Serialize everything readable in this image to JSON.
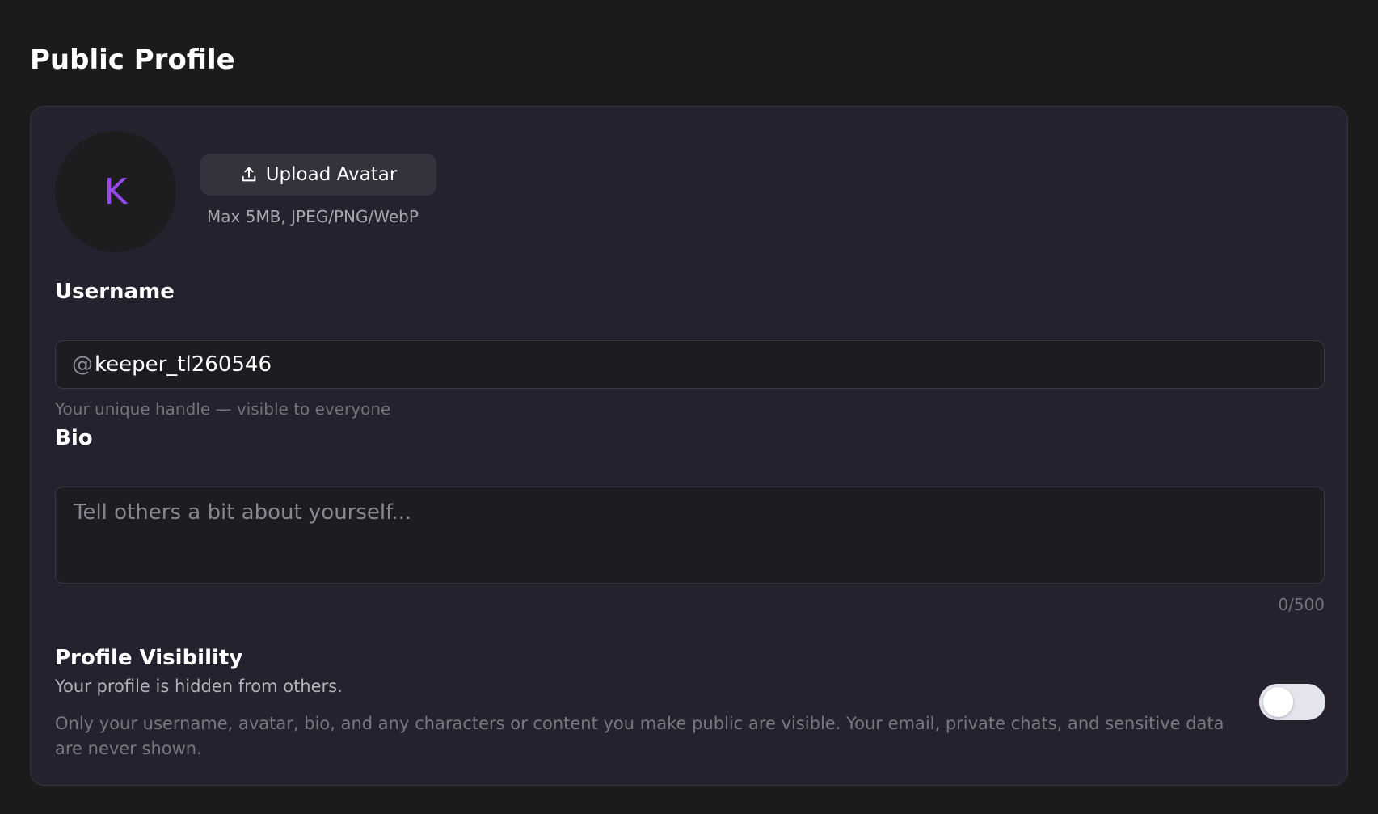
{
  "page": {
    "title": "Public Profile"
  },
  "avatar": {
    "initial": "K",
    "initial_color": "#9a49ee",
    "upload_label": "Upload Avatar",
    "upload_icon": "upload-icon",
    "hint": "Max 5MB, JPEG/PNG/WebP"
  },
  "username": {
    "label": "Username",
    "prefix": "@",
    "value": "keeper_tl260546",
    "helper": "Your unique handle — visible to everyone"
  },
  "bio": {
    "label": "Bio",
    "placeholder": "Tell others a bit about yourself...",
    "value": "",
    "char_count": "0/500"
  },
  "visibility": {
    "label": "Profile Visibility",
    "status": "Your profile is hidden from others.",
    "note": "Only your username, avatar, bio, and any characters or content you make public are visible. Your email, private chats, and sensitive data are never shown.",
    "enabled": false
  },
  "colors": {
    "background": "#1b1b1c",
    "card": "#25212e",
    "accent": "#9a49ee"
  }
}
